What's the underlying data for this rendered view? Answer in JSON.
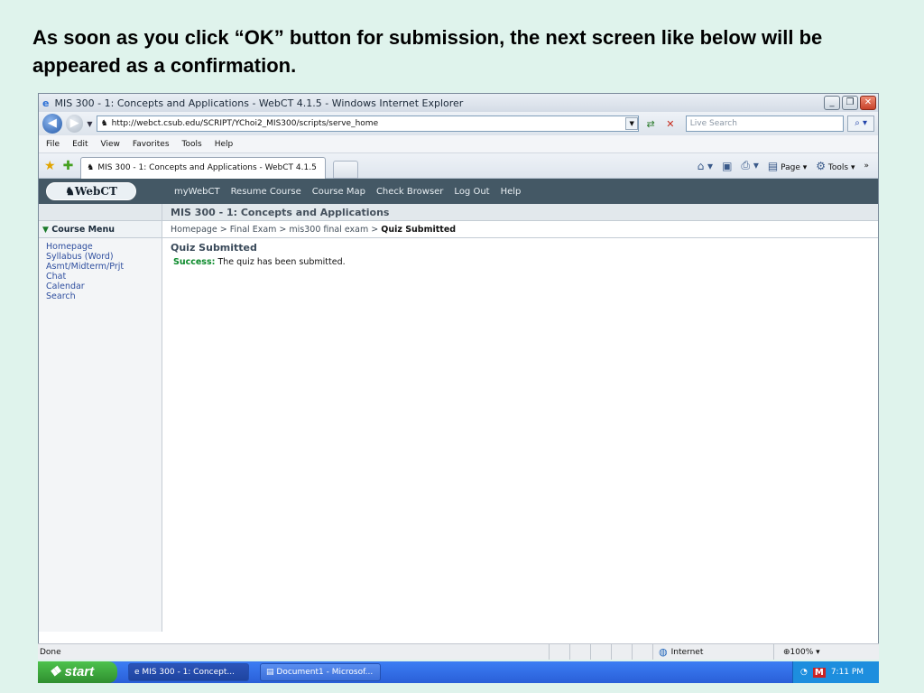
{
  "caption": "As soon as you click “OK” button for submission, the next screen like below will be appeared as a confirmation.",
  "window": {
    "title": "MIS 300 - 1: Concepts and Applications - WebCT 4.1.5 - Windows Internet Explorer",
    "url": "http://webct.csub.edu/SCRIPT/YChoi2_MIS300/scripts/serve_home",
    "search_placeholder": "Live Search",
    "menu": [
      "File",
      "Edit",
      "View",
      "Favorites",
      "Tools",
      "Help"
    ],
    "tab_label": "MIS 300 - 1: Concepts and Applications - WebCT 4.1.5",
    "page_cmd": "Page",
    "tools_cmd": "Tools"
  },
  "webct": {
    "logo": "WebCT",
    "nav": [
      "myWebCT",
      "Resume Course",
      "Course Map",
      "Check Browser",
      "Log Out",
      "Help"
    ],
    "course_title": "MIS 300 - 1: Concepts and Applications",
    "menu_heading": "Course Menu",
    "menu_items": [
      "Homepage",
      "Syllabus (Word)",
      "Asmt/Midterm/Prjt",
      "Chat",
      "Calendar",
      "Search"
    ],
    "breadcrumb": {
      "path": "Homepage > Final Exam > mis300 final exam > ",
      "current": "Quiz Submitted"
    },
    "page_title": "Quiz Submitted",
    "success_label": "Success:",
    "success_text": " The quiz has been submitted."
  },
  "status": {
    "text": "Done",
    "zone": "Internet",
    "zoom": "100%"
  },
  "taskbar": {
    "start": "start",
    "tasks": [
      "MIS 300 - 1: Concept...",
      "Document1 - Microsof..."
    ],
    "clock": "7:11 PM"
  }
}
